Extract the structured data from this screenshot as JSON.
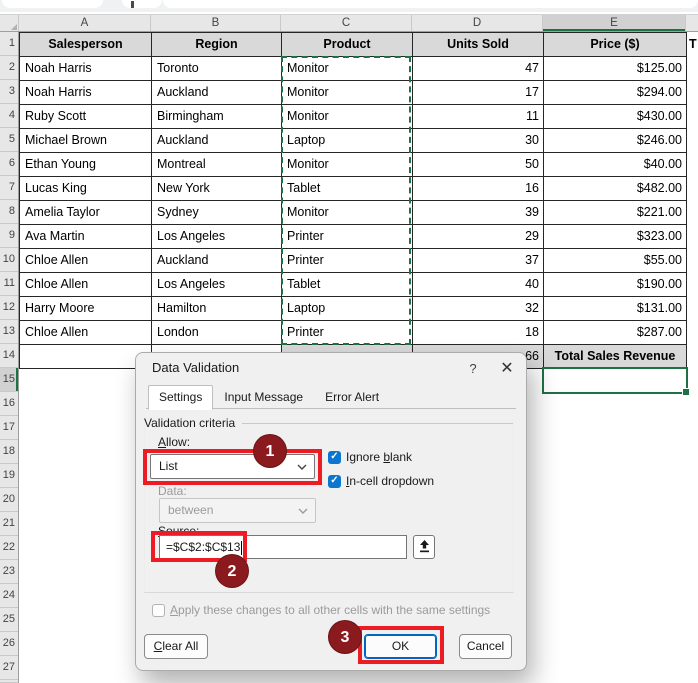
{
  "sheet": {
    "columns": [
      "A",
      "B",
      "C",
      "D",
      "E"
    ],
    "row_count": 27,
    "selection": {
      "cell": "E15",
      "column": "E",
      "row": 15,
      "ants_range": "C2:C13"
    },
    "table": {
      "headers": [
        "Salesperson",
        "Region",
        "Product",
        "Units Sold",
        "Price ($)"
      ],
      "data": [
        [
          "Noah Harris",
          "Toronto",
          "Monitor",
          "47",
          "$125.00"
        ],
        [
          "Noah Harris",
          "Auckland",
          "Monitor",
          "17",
          "$294.00"
        ],
        [
          "Ruby Scott",
          "Birmingham",
          "Monitor",
          "11",
          "$430.00"
        ],
        [
          "Michael Brown",
          "Auckland",
          "Laptop",
          "30",
          "$246.00"
        ],
        [
          "Ethan Young",
          "Montreal",
          "Monitor",
          "50",
          "$40.00"
        ],
        [
          "Lucas King",
          "New York",
          "Tablet",
          "16",
          "$482.00"
        ],
        [
          "Amelia Taylor",
          "Sydney",
          "Monitor",
          "39",
          "$221.00"
        ],
        [
          "Ava Martin",
          "Los Angeles",
          "Printer",
          "29",
          "$323.00"
        ],
        [
          "Chloe Allen",
          "Auckland",
          "Printer",
          "37",
          "$55.00"
        ],
        [
          "Chloe Allen",
          "Los Angeles",
          "Tablet",
          "40",
          "$190.00"
        ],
        [
          "Harry Moore",
          "Hamilton",
          "Laptop",
          "32",
          "$131.00"
        ],
        [
          "Chloe Allen",
          "London",
          "Printer",
          "18",
          "$287.00"
        ]
      ],
      "total_row": {
        "units_visible": "66",
        "label": "Total Sales Revenue"
      },
      "overflow_fragment_f1": "T"
    }
  },
  "dialog": {
    "title": "Data Validation",
    "help_glyph": "?",
    "close_glyph": "✕",
    "tabs": [
      {
        "label": "Settings"
      },
      {
        "label": "Input Message"
      },
      {
        "label": "Error Alert"
      }
    ],
    "active_tab": "Settings",
    "group_label": "Validation criteria",
    "allow_label": {
      "accel": "A",
      "rest": "llow:"
    },
    "allow_value": "List",
    "ignore_blank": {
      "pre": "Ignore ",
      "accel": "b",
      "rest": "lank",
      "checked": true
    },
    "incell_dropdown": {
      "accel": "I",
      "rest": "n-cell dropdown",
      "checked": true
    },
    "check_glyph": "✓",
    "data_label": "Data:",
    "data_value": "between",
    "source_label": {
      "accel": "S",
      "rest": "ource:"
    },
    "source_value": "=$C$2:$C$13",
    "apply_label": {
      "accel": "A",
      "rest": "pply these changes to all other cells with the same settings"
    },
    "buttons": {
      "clear_all": {
        "accel": "C",
        "rest": "lear All"
      },
      "ok": "OK",
      "cancel": "Cancel"
    }
  },
  "annotations": {
    "badges": [
      "1",
      "2",
      "3"
    ]
  },
  "colors": {
    "excel_green": "#1e7145",
    "annotation_red": "#ed1c24",
    "badge_maroon": "#8b1a1f",
    "checkbox_blue": "#0b76cf",
    "header_fill": "#d9d9d9"
  }
}
